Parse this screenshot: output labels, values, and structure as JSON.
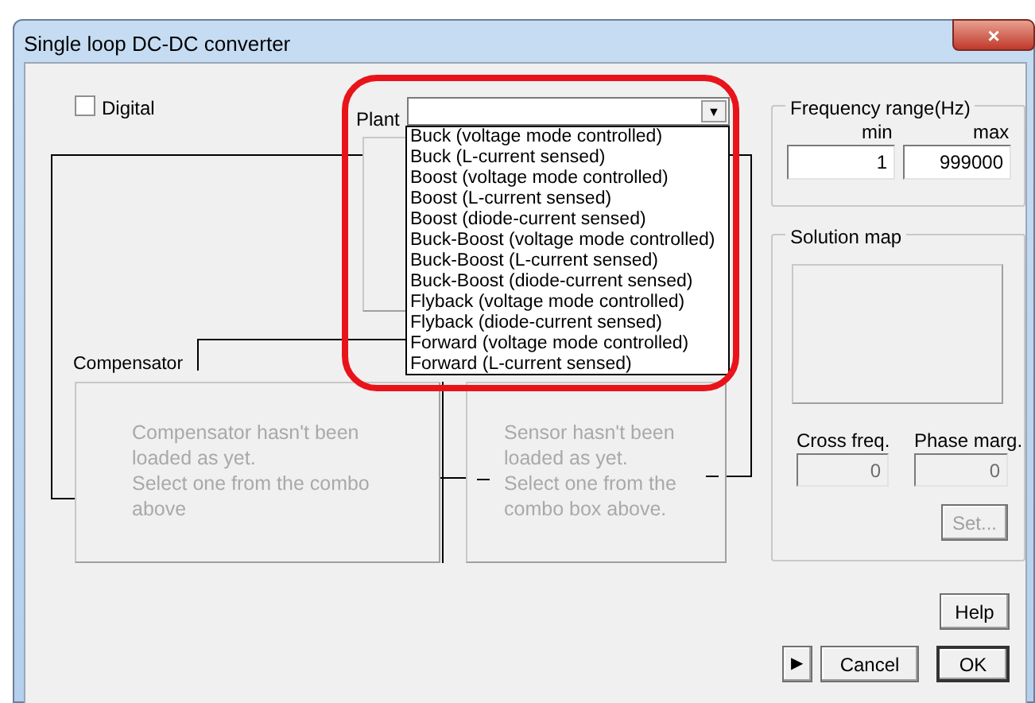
{
  "window": {
    "title": "Single loop DC-DC converter",
    "close": "×"
  },
  "digital": {
    "label": "Digital",
    "checked": false
  },
  "plant": {
    "label": "Plant",
    "arrow": "▼",
    "options": [
      {
        "label": "Buck (voltage mode controlled)"
      },
      {
        "label": "Buck (L-current sensed)"
      },
      {
        "label": "Boost (voltage mode controlled)"
      },
      {
        "label": "Boost (L-current sensed)"
      },
      {
        "label": "Boost (diode-current sensed)"
      },
      {
        "label": "Buck-Boost (voltage mode controlled)"
      },
      {
        "label": "Buck-Boost (L-current sensed)"
      },
      {
        "label": "Buck-Boost (diode-current sensed)"
      },
      {
        "label": "Flyback (voltage mode controlled)"
      },
      {
        "label": "Flyback (diode-current sensed)"
      },
      {
        "label": "Forward (voltage mode controlled)"
      },
      {
        "label": "Forward (L-current sensed)"
      }
    ]
  },
  "compensator": {
    "label": "Compensator",
    "message": "Compensator hasn't been\nloaded as yet.\nSelect one from the combo\nabove"
  },
  "sensor": {
    "message": "Sensor hasn't been\nloaded as yet.\nSelect one from the\ncombo box above."
  },
  "frequency_range": {
    "title": "Frequency range(Hz)",
    "min_label": "min",
    "max_label": "max",
    "min": "1",
    "max": "999000"
  },
  "solution_map": {
    "title": "Solution map",
    "cross_label": "Cross freq.",
    "cross_value": "0",
    "phase_label": "Phase marg.",
    "phase_value": "0",
    "set_button": {
      "label": "Set...",
      "disabled": true
    },
    "readouts_disabled": true
  },
  "buttons": {
    "help": "Help",
    "arrow": "▶",
    "cancel": "Cancel",
    "ok": "OK"
  }
}
